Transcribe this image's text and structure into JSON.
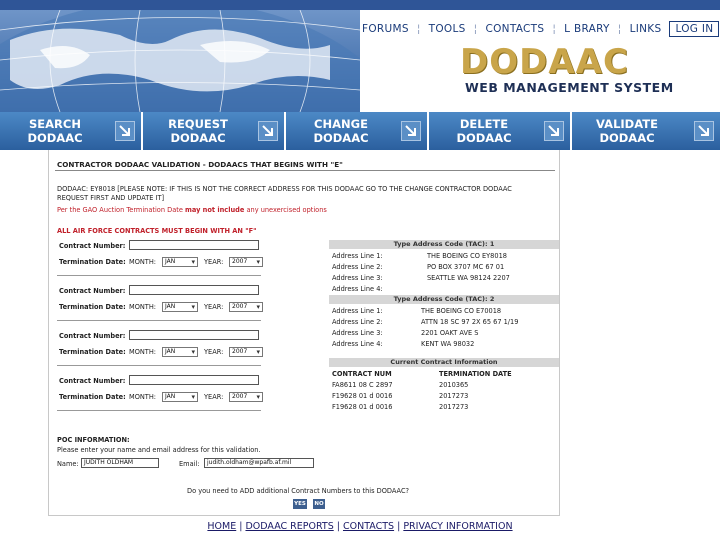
{
  "header": {
    "nav": [
      "FORUMS",
      "TOOLS",
      "CONTACTS",
      "L BRARY",
      "LINKS"
    ],
    "login": "LOG IN",
    "logo": "DODAAC",
    "subtitle": "WEB MANAGEMENT SYSTEM"
  },
  "actions": [
    {
      "line1": "SEARCH",
      "line2": "DODAAC"
    },
    {
      "line1": "REQUEST",
      "line2": "DODAAC"
    },
    {
      "line1": "CHANGE",
      "line2": "DODAAC"
    },
    {
      "line1": "DELETE",
      "line2": "DODAAC"
    },
    {
      "line1": "VALIDATE",
      "line2": "DODAAC"
    }
  ],
  "page": {
    "title": "CONTRACTOR DODAAC VALIDATION - DODAACS THAT BEGINS WITH \"E\"",
    "note1": "DODAAC: EY8018 [PLEASE NOTE: IF THIS IS NOT THE CORRECT ADDRESS FOR THIS DODAAC GO TO THE CHANGE CONTRACTOR DODAAC",
    "note2": "REQUEST FIRST AND UPDATE IT]",
    "warning_prefix": "Per the GAO Auction Termination Date ",
    "warning_bold": "may not include",
    "warning_suffix": " any unexercised options",
    "air_force": "ALL AIR FORCE CONTRACTS MUST BEGIN WITH AN \"F\"",
    "contract_label": "Contract Number:",
    "termination_label": "Termination Date:",
    "month_label": "MONTH:",
    "year_label": "YEAR:",
    "month_value": "JAN",
    "year_value": "2007"
  },
  "tac1": {
    "header": "Type Address Code (TAC): 1",
    "lines": [
      {
        "label": "Address Line 1:",
        "value": "THE BOEING CO EY8018"
      },
      {
        "label": "Address Line 2:",
        "value": "PO BOX 3707 MC 67 01"
      },
      {
        "label": "Address Line 3:",
        "value": "SEATTLE WA 98124 2207"
      },
      {
        "label": "Address Line 4:",
        "value": ""
      }
    ]
  },
  "tac2": {
    "header": "Type Address Code (TAC): 2",
    "lines": [
      {
        "label": "Address Line 1:",
        "value": "THE BOEING CO E70018"
      },
      {
        "label": "Address Line 2:",
        "value": "ATTN 18 SC 97 2X 65 67 1/19"
      },
      {
        "label": "Address Line 3:",
        "value": "2201 OAKT AVE S"
      },
      {
        "label": "Address Line 4:",
        "value": "KENT WA 98032"
      }
    ]
  },
  "current": {
    "header": "Current Contract Information",
    "col1": "CONTRACT NUM",
    "col2": "TERMINATION DATE",
    "rows": [
      {
        "num": "FA8611 08 C 2897",
        "date": "2010365"
      },
      {
        "num": "F19628 01 d 0016",
        "date": "2017273"
      },
      {
        "num": "F19628 01 d 0016",
        "date": "2017273"
      }
    ]
  },
  "poc": {
    "heading": "POC INFORMATION:",
    "instruction": "Please enter your name and email address for this validation.",
    "name_label": "Name:",
    "name_value": "JUDITH OLDHAM",
    "email_label": "Email:",
    "email_value": "judith.oldham@wpafb.af.mil",
    "question": "Do you need to ADD additional Contract Numbers to this DODAAC?",
    "yes": "YES",
    "no": "NO"
  },
  "footer": {
    "links": [
      "HOME",
      "DODAAC REPORTS",
      "CONTACTS",
      "PRIVACY INFORMATION"
    ],
    "sep": " | "
  }
}
